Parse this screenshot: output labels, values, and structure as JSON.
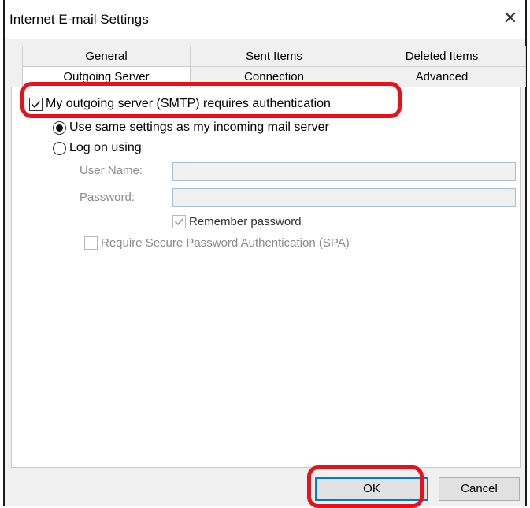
{
  "window": {
    "title": "Internet E-mail Settings",
    "close_glyph": "✕"
  },
  "tabs": {
    "back_row": [
      {
        "label": "General"
      },
      {
        "label": "Sent Items"
      },
      {
        "label": "Deleted Items"
      }
    ],
    "front_row": [
      {
        "label": "Outgoing Server",
        "active": true
      },
      {
        "label": "Connection"
      },
      {
        "label": "Advanced"
      }
    ]
  },
  "outgoing": {
    "requires_auth_label": "My outgoing server (SMTP) requires authentication",
    "requires_auth_checked": true,
    "use_same_label": "Use same settings as my incoming mail server",
    "use_same_selected": true,
    "log_on_label": "Log on using",
    "log_on_selected": false,
    "username_label": "User Name:",
    "username_value": "",
    "password_label": "Password:",
    "password_value": "",
    "remember_label": "Remember password",
    "remember_checked": true,
    "spa_label": "Require Secure Password Authentication (SPA)",
    "spa_checked": false
  },
  "buttons": {
    "ok": "OK",
    "cancel": "Cancel"
  },
  "colors": {
    "highlight": "#e8101a",
    "default_button_border": "#0078d7",
    "field_border": "#a9bfd6"
  }
}
